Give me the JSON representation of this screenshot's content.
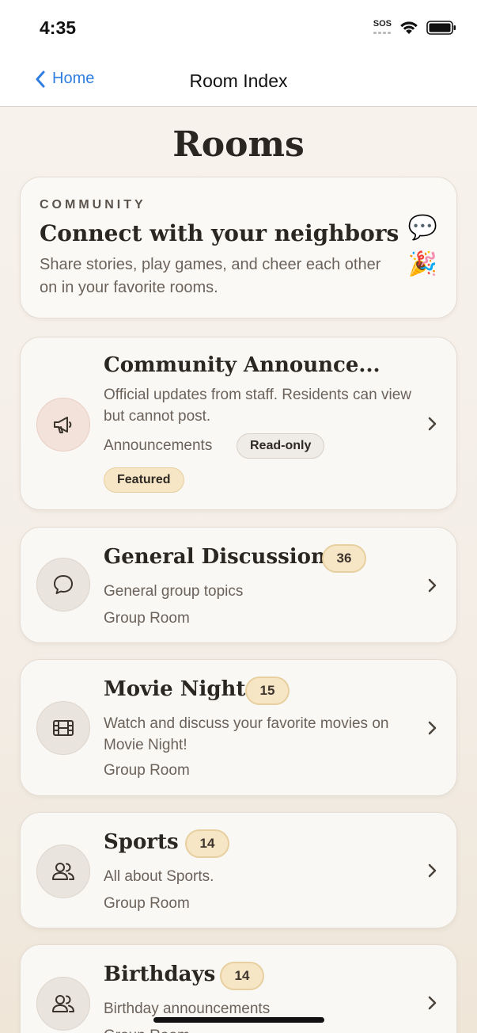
{
  "status": {
    "time": "4:35",
    "sos": "SOS"
  },
  "nav": {
    "back_label": "Home",
    "title": "Room Index"
  },
  "page": {
    "title": "Rooms"
  },
  "hero": {
    "eyebrow": "COMMUNITY",
    "title": "Connect with your neighbors",
    "subtitle": "Share stories, play games, and cheer each other on in your favorite rooms.",
    "emoji_1": "💬",
    "emoji_2": "🎉"
  },
  "rooms": [
    {
      "name": "Community Announce...",
      "description": "Official updates from staff. Residents can view but cannot post.",
      "type": "Announcements",
      "tags": [
        "Read-only",
        "Featured"
      ],
      "icon": "megaphone-icon"
    },
    {
      "name": "General Discussion",
      "count": "36",
      "description": "General group topics",
      "type": "Group Room",
      "icon": "chat-bubble-icon"
    },
    {
      "name": "Movie Night",
      "count": "15",
      "description": "Watch and discuss your favorite movies on Movie Night!",
      "type": "Group Room",
      "icon": "film-icon"
    },
    {
      "name": "Sports",
      "count": "14",
      "description": "All about Sports.",
      "type": "Group Room",
      "icon": "people-icon"
    },
    {
      "name": "Birthdays",
      "count": "14",
      "description": "Birthday announcements",
      "type": "Group Room",
      "icon": "people-icon"
    }
  ],
  "colors": {
    "accent_blue": "#2f7ee0",
    "badge_fill": "#f6e6c6",
    "badge_border": "#e7cf9f",
    "card_bg": "#faf8f5",
    "page_bg": "#f4efe9"
  }
}
